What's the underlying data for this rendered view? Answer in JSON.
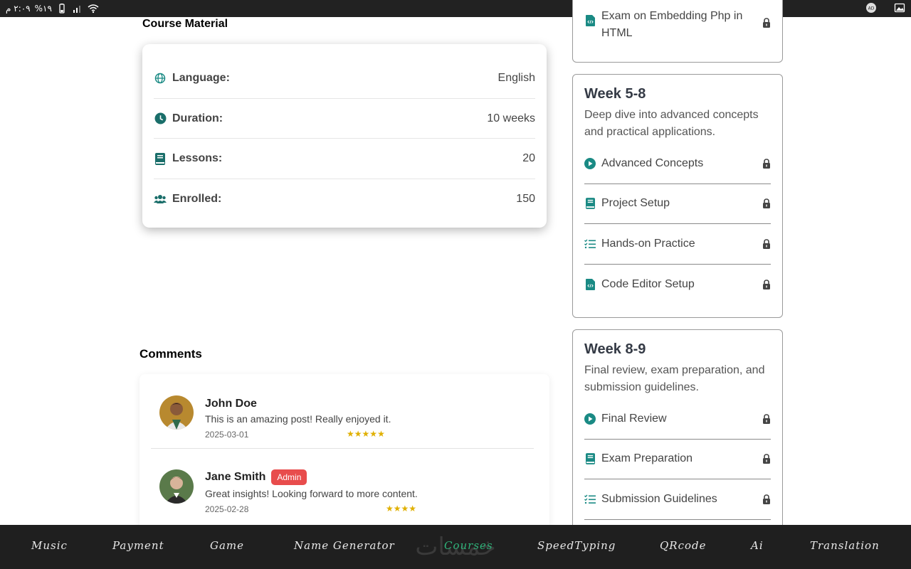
{
  "status_bar": {
    "time": "٢:٠٩ م",
    "battery": "%١٩"
  },
  "course_material": {
    "title": "Course Material",
    "rows": [
      {
        "label": "Language:",
        "value": "English",
        "icon": "globe-icon"
      },
      {
        "label": "Duration:",
        "value": "10 weeks",
        "icon": "clock-icon"
      },
      {
        "label": "Lessons:",
        "value": "20",
        "icon": "book-icon"
      },
      {
        "label": "Enrolled:",
        "value": "150",
        "icon": "users-icon"
      }
    ]
  },
  "comments": {
    "title": "Comments",
    "items": [
      {
        "name": "John Doe",
        "text": "This is an amazing post! Really enjoyed it.",
        "date": "2025-03-01",
        "rating": 5,
        "badge": ""
      },
      {
        "name": "Jane Smith",
        "text": "Great insights! Looking forward to more content.",
        "date": "2025-02-28",
        "rating": 4,
        "badge": "Admin"
      }
    ]
  },
  "weeks": {
    "top_partial": {
      "lesson": "Exam on Embedding Php in HTML"
    },
    "items": [
      {
        "title": "Week 5-8",
        "description": "Deep dive into advanced concepts and practical applications.",
        "lessons": [
          {
            "label": "Advanced Concepts",
            "icon": "play-circle-icon"
          },
          {
            "label": "Project Setup",
            "icon": "book-icon"
          },
          {
            "label": "Hands-on Practice",
            "icon": "list-check-icon"
          },
          {
            "label": "Code Editor Setup",
            "icon": "code-file-icon"
          }
        ]
      },
      {
        "title": "Week 8-9",
        "description": "Final review, exam preparation, and submission guidelines.",
        "lessons": [
          {
            "label": "Final Review",
            "icon": "play-circle-icon"
          },
          {
            "label": "Exam Preparation",
            "icon": "book-icon"
          },
          {
            "label": "Submission Guidelines",
            "icon": "list-check-icon"
          }
        ]
      }
    ]
  },
  "bottom_nav": {
    "items": [
      "Music",
      "Payment",
      "Game",
      "Name Generator",
      "Courses",
      "SpeedTyping",
      "QRcode",
      "Ai",
      "Translation"
    ],
    "active": "Courses",
    "watermark": "خمسات"
  },
  "colors": {
    "accent_teal": "#1a8a84",
    "badge_red": "#e84c4c",
    "star_gold": "#e0b000",
    "nav_active": "#2fb37a",
    "nav_bg": "#1f1f1f"
  }
}
